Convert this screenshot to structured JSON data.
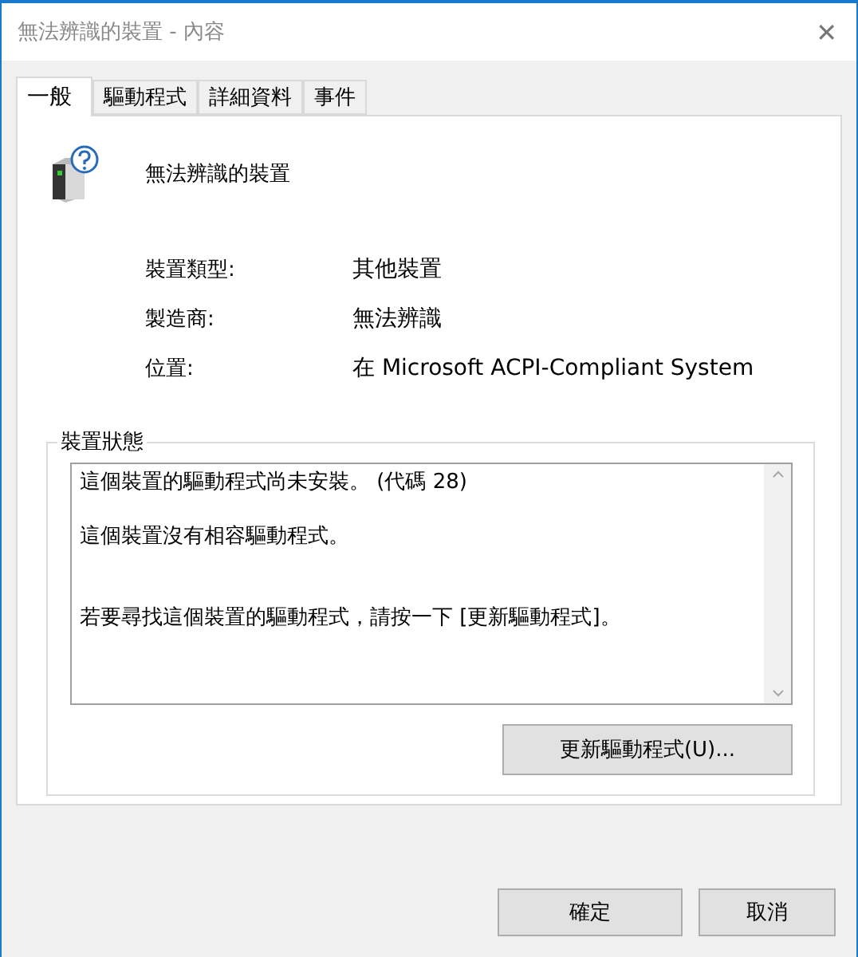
{
  "window": {
    "title": "無法辨識的裝置 - 內容",
    "close": "✕"
  },
  "tabs": [
    {
      "label": "一般",
      "selected": true
    },
    {
      "label": "驅動程式",
      "selected": false
    },
    {
      "label": "詳細資料",
      "selected": false
    },
    {
      "label": "事件",
      "selected": false
    }
  ],
  "device": {
    "name": "無法辨識的裝置"
  },
  "properties": [
    {
      "label": "裝置類型:",
      "value": "其他裝置"
    },
    {
      "label": "製造商:",
      "value": "無法辨識"
    },
    {
      "label": "位置:",
      "value": "在 Microsoft ACPI-Compliant System"
    }
  ],
  "status": {
    "legend": "裝置狀態",
    "paragraphs": [
      "這個裝置的驅動程式尚未安裝。 (代碼 28)",
      "這個裝置沒有相容驅動程式。",
      "若要尋找這個裝置的驅動程式，請按一下 [更新驅動程式]。"
    ],
    "button": "更新驅動程式(U)..."
  },
  "buttons": [
    "確定",
    "取消"
  ]
}
